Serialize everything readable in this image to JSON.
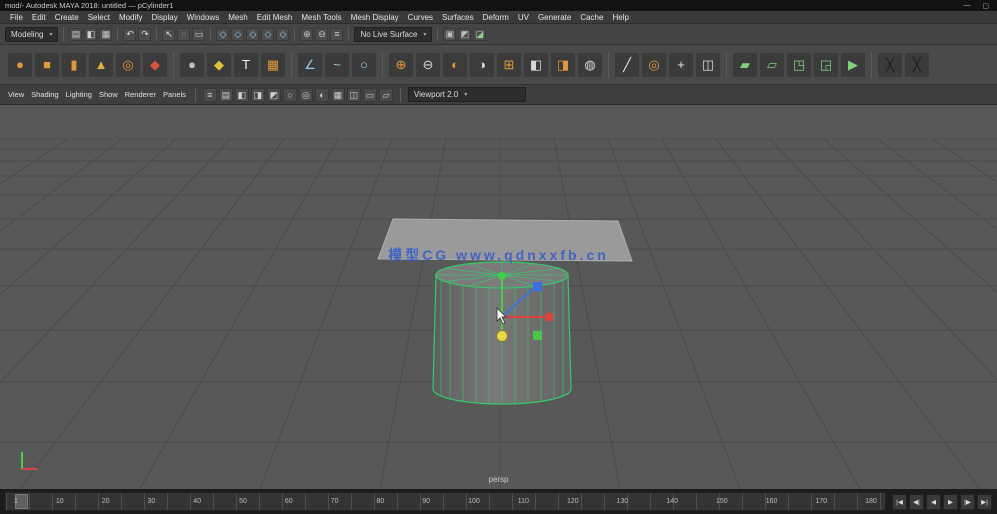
{
  "window": {
    "title": "mod/- Autodesk MAYA 2018: untitled — pCylinder1",
    "minimize": "—",
    "maximize": "▢"
  },
  "menubar": {
    "items": [
      "File",
      "Edit",
      "Create",
      "Select",
      "Modify",
      "Display",
      "Windows",
      "Mesh",
      "Edit Mesh",
      "Mesh Tools",
      "Mesh Display",
      "Curves",
      "Surfaces",
      "Deform",
      "UV",
      "Generate",
      "Cache",
      "Help"
    ]
  },
  "statusline": {
    "menuset": "Modeling",
    "dropdown_arrow": "▾",
    "live_surface": "No Live Surface",
    "icons": {
      "file": [
        {
          "name": "new-scene-icon",
          "glyph": "▤",
          "color": "#cfcfcf"
        },
        {
          "name": "open-scene-icon",
          "glyph": "◧",
          "color": "#cfcfcf"
        },
        {
          "name": "save-scene-icon",
          "glyph": "▦",
          "color": "#cfcfcf"
        }
      ],
      "undo": [
        {
          "name": "undo-icon",
          "glyph": "↶",
          "color": "#d8d8d8"
        },
        {
          "name": "redo-icon",
          "glyph": "↷",
          "color": "#d8d8d8"
        }
      ],
      "select": [
        {
          "name": "select-tool-icon",
          "glyph": "↖",
          "color": "#e0e0e0"
        },
        {
          "name": "lasso-tool-icon",
          "glyph": "◌",
          "color": "#d0d0d0"
        },
        {
          "name": "paint-select-icon",
          "glyph": "▭",
          "color": "#d0d0d0"
        }
      ],
      "snap": [
        {
          "name": "snap-grid-icon",
          "glyph": "◇",
          "color": "#9ad6ff"
        },
        {
          "name": "snap-curve-icon",
          "glyph": "◇",
          "color": "#7ec9f7"
        },
        {
          "name": "snap-point-icon",
          "glyph": "◇",
          "color": "#9ad6ff"
        },
        {
          "name": "snap-plane-icon",
          "glyph": "◇",
          "color": "#7ec9f7"
        },
        {
          "name": "snap-view-icon",
          "glyph": "◇",
          "color": "#9ad6ff"
        }
      ],
      "history": [
        {
          "name": "input-connections-icon",
          "glyph": "⊕",
          "color": "#c8c8c8"
        },
        {
          "name": "output-connections-icon",
          "glyph": "⊖",
          "color": "#c8c8c8"
        },
        {
          "name": "construction-history-icon",
          "glyph": "≡",
          "color": "#c8c8c8"
        }
      ],
      "render": [
        {
          "name": "render-current-frame-icon",
          "glyph": "▣",
          "color": "#bfbfbf"
        },
        {
          "name": "ipr-render-icon",
          "glyph": "◩",
          "color": "#bfbfbf"
        },
        {
          "name": "render-settings-icon",
          "glyph": "◪",
          "color": "#8fd18f"
        }
      ]
    }
  },
  "shelf": {
    "groups": {
      "g1": [
        {
          "name": "poly-sphere-icon",
          "glyph": "●",
          "color": "#e09a3c"
        },
        {
          "name": "poly-cube-icon",
          "glyph": "■",
          "color": "#e09a3c"
        },
        {
          "name": "poly-cylinder-icon",
          "glyph": "▮",
          "color": "#e09a3c"
        },
        {
          "name": "poly-cone-icon",
          "glyph": "▲",
          "color": "#e0b23c"
        },
        {
          "name": "poly-torus-icon",
          "glyph": "◎",
          "color": "#e09a3c"
        },
        {
          "name": "poly-plane-icon",
          "glyph": "◆",
          "color": "#d9543c"
        }
      ],
      "g2": [
        {
          "name": "smooth-sphere-icon",
          "glyph": "●",
          "color": "#b9c2cc"
        },
        {
          "name": "platonic-solid-icon",
          "glyph": "◆",
          "color": "#e0c23c"
        },
        {
          "name": "type-tool-icon",
          "glyph": "T",
          "color": "#f2f2f2"
        },
        {
          "name": "svg-tool-icon",
          "glyph": "▦",
          "color": "#e09a3c"
        }
      ],
      "g3": [
        {
          "name": "measure-distance-icon",
          "glyph": "∠",
          "color": "#9ac8e8"
        },
        {
          "name": "curve-tool-icon",
          "glyph": "~",
          "color": "#9ac8e8"
        },
        {
          "name": "circle-curve-icon",
          "glyph": "○",
          "color": "#9ac8e8"
        }
      ],
      "g4": [
        {
          "name": "combine-icon",
          "glyph": "⊕",
          "color": "#e09a3c"
        },
        {
          "name": "separate-icon",
          "glyph": "⊖",
          "color": "#d8d8d8"
        },
        {
          "name": "boolean-union-icon",
          "glyph": "◐",
          "color": "#e09a3c"
        },
        {
          "name": "boolean-difference-icon",
          "glyph": "◑",
          "color": "#d8d8d8"
        },
        {
          "name": "extrude-icon",
          "glyph": "⊞",
          "color": "#e09a3c"
        },
        {
          "name": "bevel-icon",
          "glyph": "◧",
          "color": "#d8d8d8"
        },
        {
          "name": "bridge-icon",
          "glyph": "◨",
          "color": "#e09a3c"
        },
        {
          "name": "smooth-icon",
          "glyph": "◍",
          "color": "#d8d8d8"
        }
      ],
      "g5": [
        {
          "name": "multi-cut-icon",
          "glyph": "╱",
          "color": "#e8e8e8"
        },
        {
          "name": "target-weld-icon",
          "glyph": "◎",
          "color": "#e09a3c"
        },
        {
          "name": "connect-icon",
          "glyph": "+",
          "color": "#e8e8e8"
        },
        {
          "name": "mirror-icon",
          "glyph": "◫",
          "color": "#d8d8d8"
        }
      ],
      "g6": [
        {
          "name": "quad-draw-icon",
          "glyph": "▰",
          "color": "#7ed27e"
        },
        {
          "name": "relax-tool-icon",
          "glyph": "▱",
          "color": "#7ed27e"
        },
        {
          "name": "grab-tool-icon",
          "glyph": "◳",
          "color": "#7ed27e"
        },
        {
          "name": "pinch-tool-icon",
          "glyph": "◲",
          "color": "#7ed27e"
        },
        {
          "name": "sculpt-tool-icon",
          "glyph": "▶",
          "color": "#7ed27e"
        }
      ],
      "g7": [
        {
          "name": "mirror-cut-icon",
          "glyph": "╳",
          "color": "#1e1e1e"
        },
        {
          "name": "delete-icon",
          "glyph": "╳",
          "color": "#1e1e1e"
        }
      ]
    }
  },
  "panelbar": {
    "menus": [
      "View",
      "Shading",
      "Lighting",
      "Show",
      "Renderer",
      "Panels"
    ],
    "renderer": "Viewport 2.0",
    "icons": [
      {
        "name": "panel-layout-icon",
        "glyph": "≡"
      },
      {
        "name": "wireframe-mode-icon",
        "glyph": "▤"
      },
      {
        "name": "smooth-shade-icon",
        "glyph": "◧"
      },
      {
        "name": "textured-mode-icon",
        "glyph": "◨"
      },
      {
        "name": "lighting-mode-icon",
        "glyph": "◩"
      },
      {
        "name": "shadows-toggle-icon",
        "glyph": "○"
      },
      {
        "name": "ao-toggle-icon",
        "glyph": "◎"
      },
      {
        "name": "motion-blur-toggle-icon",
        "glyph": "◐"
      },
      {
        "name": "grid-toggle-icon",
        "glyph": "▦"
      },
      {
        "name": "film-gate-icon",
        "glyph": "◫"
      },
      {
        "name": "resolution-gate-icon",
        "glyph": "▭"
      },
      {
        "name": "isolate-select-icon",
        "glyph": "▱"
      }
    ]
  },
  "viewport": {
    "camera_label": "persp",
    "watermark": "模型CG www.qdnxxfb.cn"
  },
  "timeline": {
    "ticks": [
      "1",
      "10",
      "20",
      "30",
      "40",
      "50",
      "60",
      "70",
      "80",
      "90",
      "100",
      "110",
      "120",
      "130",
      "140",
      "150",
      "160",
      "170",
      "180"
    ],
    "transport": [
      {
        "name": "go-to-start-button",
        "glyph": "|◀"
      },
      {
        "name": "step-back-frame-button",
        "glyph": "◀|"
      },
      {
        "name": "play-backwards-button",
        "glyph": "◀"
      },
      {
        "name": "play-forwards-button",
        "glyph": "▶"
      },
      {
        "name": "step-forward-frame-button",
        "glyph": "|▶"
      },
      {
        "name": "go-to-end-button",
        "glyph": "▶|"
      }
    ]
  },
  "colors": {
    "wire": "#35c96b",
    "axis-x": "#e04040",
    "axis-y": "#46cf46",
    "axis-z": "#3e6fe0",
    "center": "#e8d64c",
    "watermark": "#3b5fc9"
  }
}
